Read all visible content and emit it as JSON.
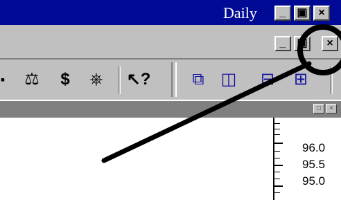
{
  "window": {
    "title": "Daily",
    "buttons": {
      "minimize": "_",
      "restore": "▣",
      "close": "×"
    }
  },
  "menubar": {
    "buttons": {
      "minimize": "_",
      "restore": "▣",
      "close": "×"
    }
  },
  "toolbar": {
    "icons": [
      {
        "name": "scale-icon",
        "glyph": "⚖"
      },
      {
        "name": "dollar-icon",
        "glyph": "$"
      },
      {
        "name": "binoculars-icon",
        "glyph": "⎈"
      },
      {
        "name": "help-pointer-icon",
        "glyph": "↖?"
      },
      {
        "name": "cascade-windows-icon",
        "glyph": "⧉"
      },
      {
        "name": "tile-vertical-icon",
        "glyph": "◫"
      },
      {
        "name": "tile-horizontal-icon",
        "glyph": "⊟"
      },
      {
        "name": "tile-grid-icon",
        "glyph": "⊞"
      }
    ]
  },
  "inner_window": {
    "buttons": {
      "restore": "□",
      "close": "×"
    }
  },
  "chart": {
    "y_ticks": [
      "96.0",
      "95.5",
      "95.0"
    ]
  },
  "annotation": {
    "color": "#000000"
  },
  "colors": {
    "title_bar": "#000a94",
    "chrome": "#c0c0c0",
    "inactive_bar": "#808080"
  }
}
